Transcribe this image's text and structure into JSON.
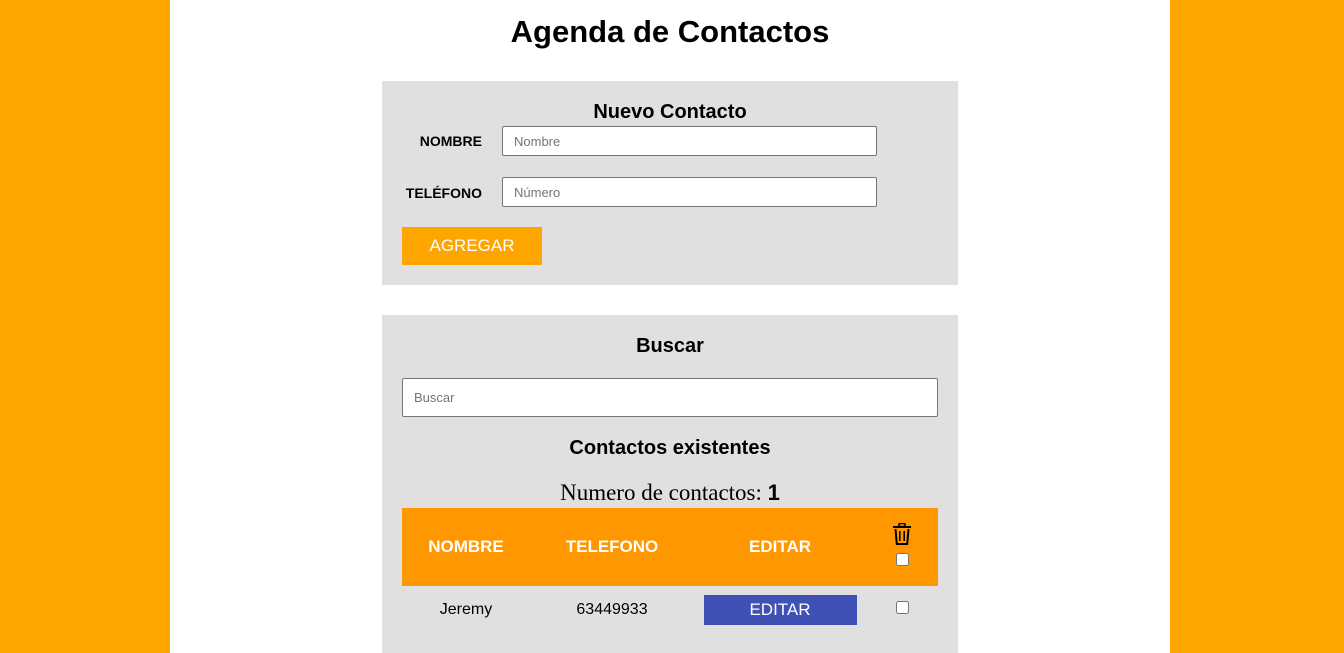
{
  "app": {
    "title": "Agenda de Contactos"
  },
  "new_contact": {
    "title": "Nuevo Contacto",
    "name_label": "NOMBRE",
    "name_value": "",
    "name_placeholder": "Nombre",
    "phone_label": "TELÉFONO",
    "phone_value": "",
    "phone_placeholder": "Número",
    "add_button": "AGREGAR"
  },
  "search": {
    "title": "Buscar",
    "value": "",
    "placeholder": "Buscar"
  },
  "contacts": {
    "title": "Contactos existentes",
    "count_label": "Numero de contactos: ",
    "count": "1",
    "headers": {
      "name": "NOMBRE",
      "phone": "TELEFONO",
      "edit": "EDITAR",
      "delete_icon": "trash-icon"
    },
    "rows": [
      {
        "name": "Jeremy",
        "phone": "63449933",
        "edit_label": "EDITAR",
        "selected": false
      }
    ],
    "select_all": false
  },
  "colors": {
    "background": "#ffa500",
    "panel": "#e0e0e0",
    "table_header": "#ff9800",
    "add_button": "#ffa500",
    "edit_button": "#3f51b5"
  }
}
